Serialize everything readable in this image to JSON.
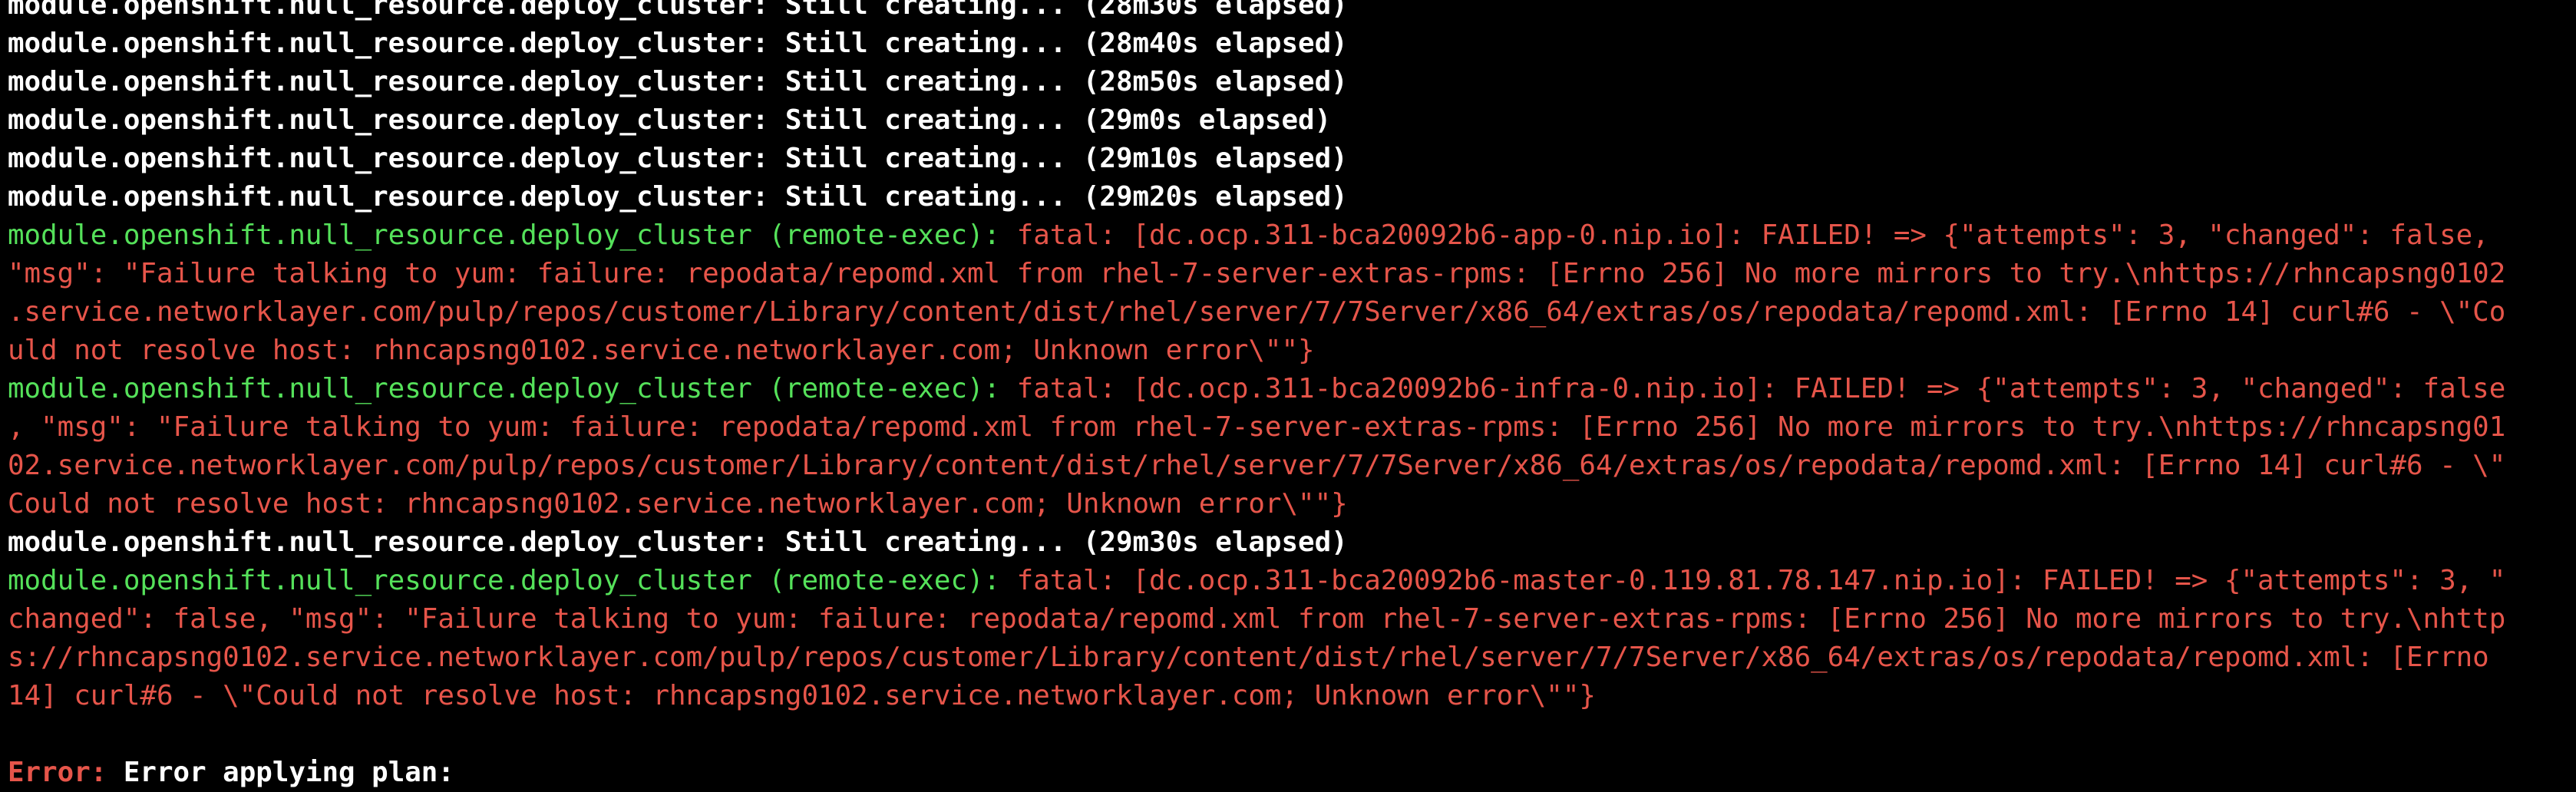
{
  "terminal": {
    "colors": {
      "background": "#000000",
      "normal_text": "#ffffff",
      "resource_green": "#55e15a",
      "error_red": "#e6554a"
    },
    "lines": [
      {
        "kind": "status",
        "text": "module.openshift.null_resource.deploy_cluster: Still creating... (28m30s elapsed)"
      },
      {
        "kind": "status",
        "text": "module.openshift.null_resource.deploy_cluster: Still creating... (28m40s elapsed)"
      },
      {
        "kind": "status",
        "text": "module.openshift.null_resource.deploy_cluster: Still creating... (28m50s elapsed)"
      },
      {
        "kind": "status",
        "text": "module.openshift.null_resource.deploy_cluster: Still creating... (29m0s elapsed)"
      },
      {
        "kind": "status",
        "text": "module.openshift.null_resource.deploy_cluster: Still creating... (29m10s elapsed)"
      },
      {
        "kind": "status",
        "text": "module.openshift.null_resource.deploy_cluster: Still creating... (29m20s elapsed)"
      },
      {
        "kind": "fatal_head",
        "prefix": "module.openshift.null_resource.deploy_cluster (remote-exec):",
        "rest": " fatal: [dc.ocp.311-bca20092b6-app-0.nip.io]: FAILED! => {\"attempts\": 3, \"changed\": false,"
      },
      {
        "kind": "fatal_cont",
        "text": "\"msg\": \"Failure talking to yum: failure: repodata/repomd.xml from rhel-7-server-extras-rpms: [Errno 256] No more mirrors to try.\\nhttps://rhncapsng0102"
      },
      {
        "kind": "fatal_cont",
        "text": ".service.networklayer.com/pulp/repos/customer/Library/content/dist/rhel/server/7/7Server/x86_64/extras/os/repodata/repomd.xml: [Errno 14] curl#6 - \\\"Co"
      },
      {
        "kind": "fatal_cont",
        "text": "uld not resolve host: rhncapsng0102.service.networklayer.com; Unknown error\\\"\"}"
      },
      {
        "kind": "fatal_head",
        "prefix": "module.openshift.null_resource.deploy_cluster (remote-exec):",
        "rest": " fatal: [dc.ocp.311-bca20092b6-infra-0.nip.io]: FAILED! => {\"attempts\": 3, \"changed\": false"
      },
      {
        "kind": "fatal_cont",
        "text": ", \"msg\": \"Failure talking to yum: failure: repodata/repomd.xml from rhel-7-server-extras-rpms: [Errno 256] No more mirrors to try.\\nhttps://rhncapsng01"
      },
      {
        "kind": "fatal_cont",
        "text": "02.service.networklayer.com/pulp/repos/customer/Library/content/dist/rhel/server/7/7Server/x86_64/extras/os/repodata/repomd.xml: [Errno 14] curl#6 - \\\""
      },
      {
        "kind": "fatal_cont",
        "text": "Could not resolve host: rhncapsng0102.service.networklayer.com; Unknown error\\\"\"}"
      },
      {
        "kind": "status",
        "text": "module.openshift.null_resource.deploy_cluster: Still creating... (29m30s elapsed)"
      },
      {
        "kind": "fatal_head",
        "prefix": "module.openshift.null_resource.deploy_cluster (remote-exec):",
        "rest": " fatal: [dc.ocp.311-bca20092b6-master-0.119.81.78.147.nip.io]: FAILED! => {\"attempts\": 3, \""
      },
      {
        "kind": "fatal_cont",
        "text": "changed\": false, \"msg\": \"Failure talking to yum: failure: repodata/repomd.xml from rhel-7-server-extras-rpms: [Errno 256] No more mirrors to try.\\nhttp"
      },
      {
        "kind": "fatal_cont",
        "text": "s://rhncapsng0102.service.networklayer.com/pulp/repos/customer/Library/content/dist/rhel/server/7/7Server/x86_64/extras/os/repodata/repomd.xml: [Errno"
      },
      {
        "kind": "fatal_cont",
        "text": "14] curl#6 - \\\"Could not resolve host: rhncapsng0102.service.networklayer.com; Unknown error\\\"\"}"
      },
      {
        "kind": "blank",
        "text": ""
      },
      {
        "kind": "error",
        "label": "Error:",
        "text": " Error applying plan:"
      }
    ]
  }
}
